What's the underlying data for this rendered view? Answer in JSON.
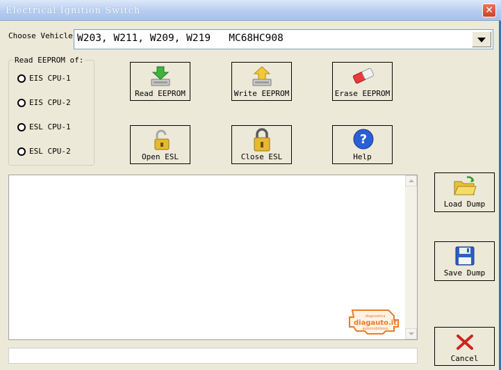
{
  "window": {
    "title": "Electrical Ignition Switch",
    "close_label": "✕"
  },
  "vehicle": {
    "label": "Choose Vehicle",
    "selected": "W203, W211, W209, W219   MC68HC908"
  },
  "read_group": {
    "title": "Read EEPROM of:",
    "options": [
      "EIS CPU-1",
      "EIS CPU-2",
      "ESL CPU-1",
      "ESL CPU-2"
    ]
  },
  "buttons": {
    "read_eeprom": "Read EEPROM",
    "write_eeprom": "Write EEPROM",
    "erase_eeprom": "Erase EEPROM",
    "open_esl": "Open ESL",
    "close_esl": "Close ESL",
    "help": "Help",
    "load_dump": "Load Dump",
    "save_dump": "Save Dump",
    "cancel": "Cancel"
  },
  "watermark": {
    "top": "diagnostica",
    "main": "diagauto.it",
    "bottom": "automobilismo"
  },
  "icons": {
    "read_eeprom": "chip-download-icon",
    "write_eeprom": "chip-upload-icon",
    "erase_eeprom": "eraser-icon",
    "open_esl": "unlocked-padlock-icon",
    "close_esl": "locked-padlock-icon",
    "help": "question-icon",
    "load_dump": "open-folder-icon",
    "save_dump": "floppy-disk-icon",
    "cancel": "red-x-icon"
  },
  "colors": {
    "window_bg": "#ece9d8",
    "titlebar": "#b6cdf0",
    "watermark": "#e87a2a"
  }
}
